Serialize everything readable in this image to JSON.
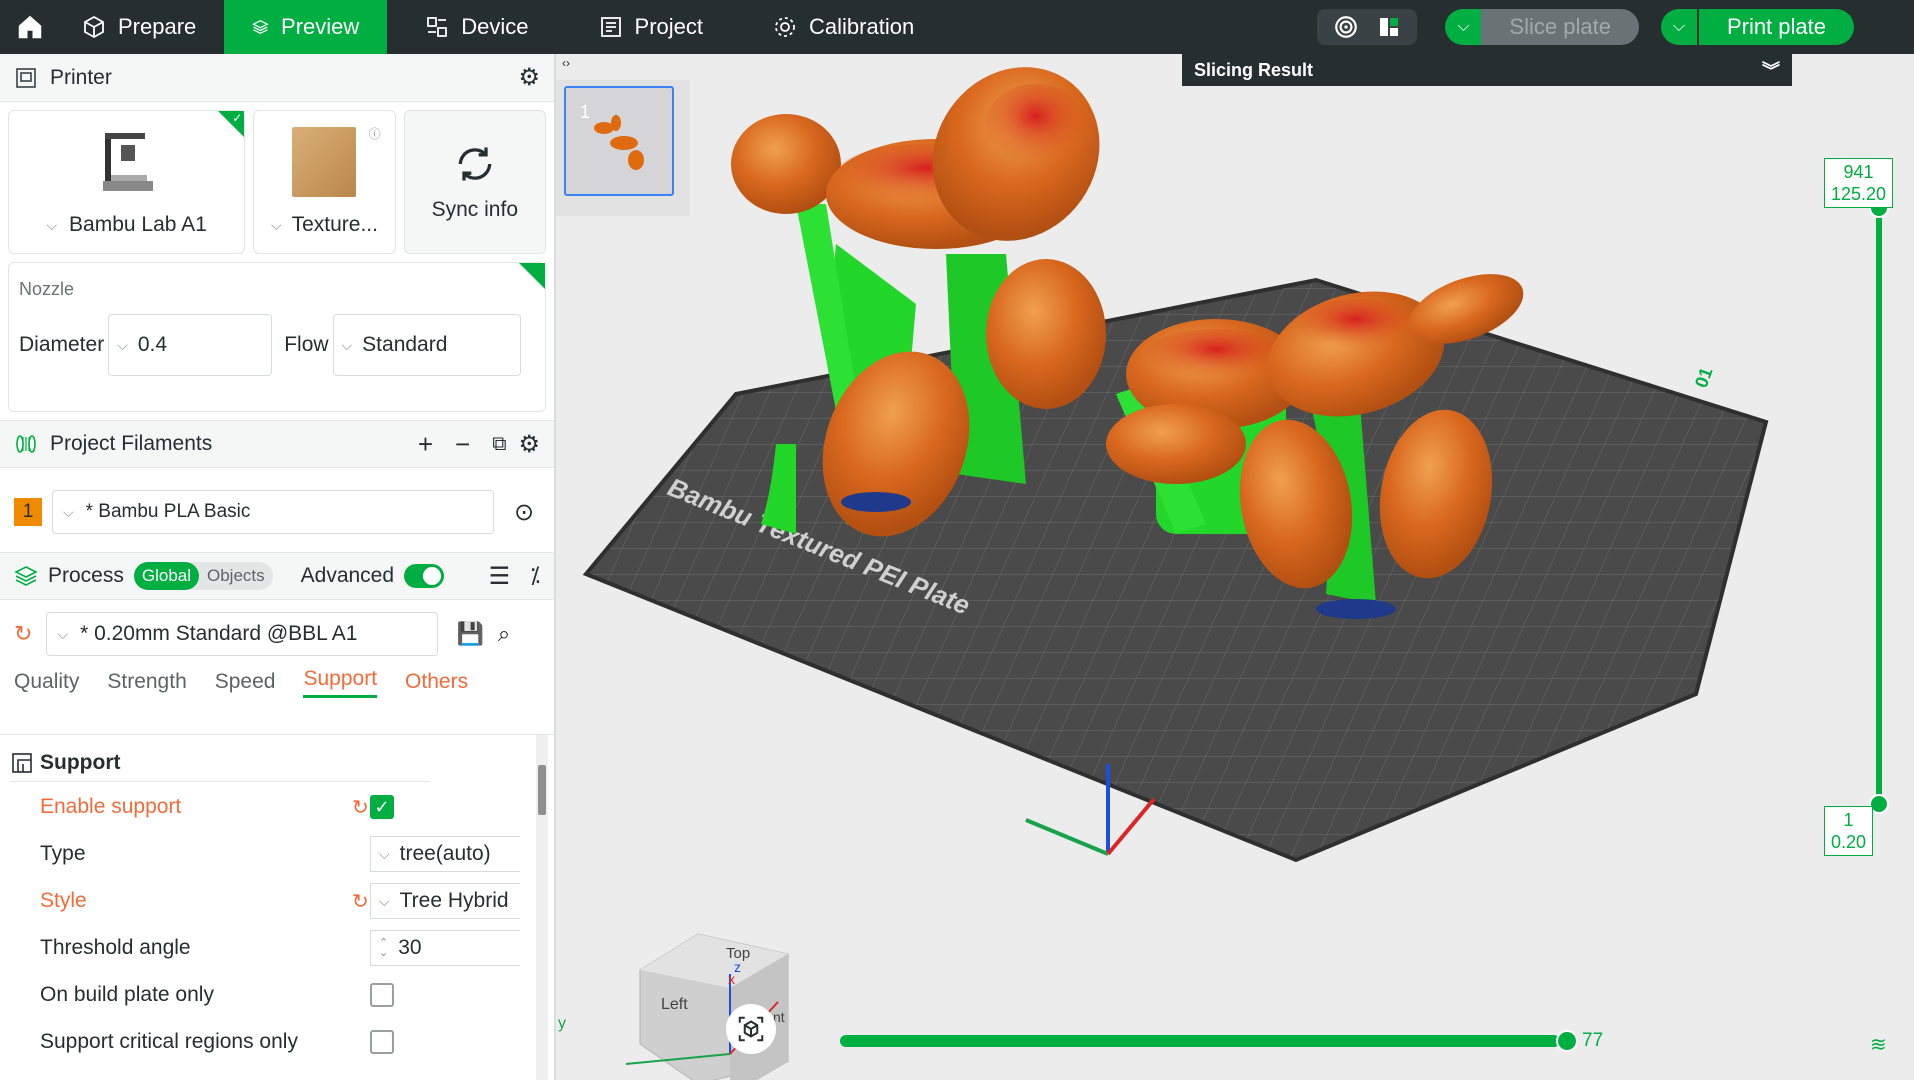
{
  "topbar": {
    "tabs": [
      {
        "label": "Prepare",
        "active": false
      },
      {
        "label": "Preview",
        "active": true
      },
      {
        "label": "Device",
        "active": false
      },
      {
        "label": "Project",
        "active": false
      },
      {
        "label": "Calibration",
        "active": false
      }
    ],
    "slice_label": "Slice plate",
    "print_label": "Print plate"
  },
  "printer": {
    "title": "Printer",
    "printer_name": "Bambu Lab A1",
    "plate_name": "Texture...",
    "sync_label": "Sync info",
    "nozzle_title": "Nozzle",
    "diameter_label": "Diameter",
    "diameter_value": "0.4",
    "flow_label": "Flow",
    "flow_value": "Standard"
  },
  "filaments": {
    "title": "Project Filaments",
    "items": [
      {
        "index": "1",
        "name": "* Bambu PLA Basic",
        "color": "#f08a00"
      }
    ]
  },
  "process": {
    "title": "Process",
    "global_label": "Global",
    "objects_label": "Objects",
    "advanced_label": "Advanced",
    "preset": "* 0.20mm Standard @BBL A1",
    "tabs": [
      "Quality",
      "Strength",
      "Speed",
      "Support",
      "Others"
    ],
    "active_tab": "Support"
  },
  "support": {
    "title": "Support",
    "rows": [
      {
        "label": "Enable support",
        "modified": true,
        "kind": "checkbox",
        "checked": true
      },
      {
        "label": "Type",
        "modified": false,
        "kind": "combo",
        "value": "tree(auto)"
      },
      {
        "label": "Style",
        "modified": true,
        "kind": "combo",
        "value": "Tree Hybrid"
      },
      {
        "label": "Threshold angle",
        "modified": false,
        "kind": "spin",
        "value": "30"
      },
      {
        "label": "On build plate only",
        "modified": false,
        "kind": "checkbox",
        "checked": false
      },
      {
        "label": "Support critical regions only",
        "modified": false,
        "kind": "checkbox",
        "checked": false
      }
    ]
  },
  "viewport": {
    "thumb_index": "1",
    "slicing_result_label": "Slicing Result",
    "plate_text": "Bambu Textured PEI Plate",
    "layer_top": "941",
    "height_top": "125.20",
    "layer_bottom": "1",
    "height_bottom": "0.20",
    "move_value": "77",
    "cube_top": "Top",
    "cube_left": "Left",
    "cube_front": "Front",
    "axis_x": "x",
    "axis_y": "y",
    "axis_z": "z",
    "plate_number": "01"
  },
  "colors": {
    "accent": "#00ae42",
    "topbar": "#262e30",
    "modified": "#f26b3a",
    "model": "#d0641e",
    "support": "#22dd22"
  }
}
